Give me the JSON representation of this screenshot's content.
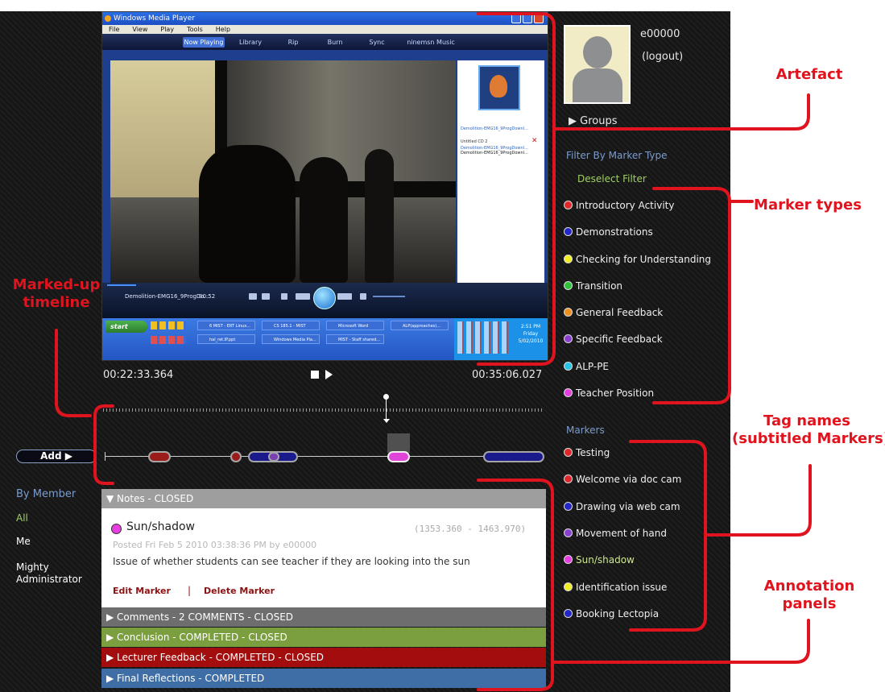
{
  "player": {
    "title": "Windows Media Player",
    "menu": [
      "File",
      "View",
      "Play",
      "Tools",
      "Help"
    ],
    "tabs": [
      "Now Playing",
      "Library",
      "Rip",
      "Burn",
      "Sync",
      "ninemsn Music"
    ],
    "side_items": [
      "Demolition-EMG16_9ProgDownl...",
      "Untitled CD 2",
      "Demolition-EMG16_9ProgDownl...",
      "Demolition-EMG16_9ProgDownl..."
    ],
    "now_playing": "Demolition-EMG16_9ProgDo...",
    "elapsed": "00:52",
    "taskbar": {
      "start": "start",
      "tasks": [
        "6 MIST - ERT Linux...",
        "CS 185.1 - MIST",
        "Microsoft Word",
        "ALP(approaches)...",
        "hal_ret.IP.ppt",
        "Windows Media Pla...",
        "MIST - Staff shared..."
      ],
      "clock": [
        "2:51 PM",
        "Friday",
        "5/02/2010"
      ]
    }
  },
  "timeline": {
    "start_time": "00:22:33.364",
    "end_time": "00:35:06.027",
    "segments": [
      {
        "color": "#9b1b1b"
      },
      {
        "color": "#9b1b1b"
      },
      {
        "color": "#1a1a8c"
      },
      {
        "color": "#7b3fb0"
      },
      {
        "color": "#e044d8"
      },
      {
        "color": "#1a1a8c"
      }
    ]
  },
  "controls": {
    "add_label": "Add ▶"
  },
  "members": {
    "title": "By Member",
    "items": [
      "All",
      "Me",
      "Mighty Administrator"
    ]
  },
  "notes": {
    "header": "▼ Notes - CLOSED",
    "marker_name": "Sun/shadow",
    "range": "(1353.360 - 1463.970)",
    "posted": "Posted Fri Feb 5 2010 03:38:36 PM by e00000",
    "body": "Issue of whether students can see teacher if they are looking into the sun",
    "edit": "Edit Marker",
    "sep": "|",
    "delete": "Delete Marker"
  },
  "panels": [
    {
      "label": "▶ Comments - 2 COMMENTS - CLOSED",
      "color": "#6e6e6e"
    },
    {
      "label": "▶ Conclusion - COMPLETED - CLOSED",
      "color": "#7b9e3f"
    },
    {
      "label": "▶ Lecturer Feedback - COMPLETED - CLOSED",
      "color": "#a30d0d"
    },
    {
      "label": "▶ Final Reflections  - COMPLETED",
      "color": "#3f6ea6"
    }
  ],
  "user": {
    "id": "e00000",
    "logout": "(logout)",
    "groups": "▶  Groups"
  },
  "filter": {
    "title": "Filter By Marker Type",
    "deselect": "Deselect Filter",
    "types": [
      {
        "label": "Introductory Activity",
        "color": "#e0282a"
      },
      {
        "label": "Demonstrations",
        "color": "#2326c8"
      },
      {
        "label": "Checking for Understanding",
        "color": "#f1ee25"
      },
      {
        "label": "Transition",
        "color": "#2ec43a"
      },
      {
        "label": "General Feedback",
        "color": "#ef8f1d"
      },
      {
        "label": "Specific Feedback",
        "color": "#8b3fd0"
      },
      {
        "label": "ALP-PE",
        "color": "#27c2e6"
      },
      {
        "label": "Teacher Position",
        "color": "#e83de0"
      }
    ]
  },
  "markers": {
    "title": "Markers",
    "items": [
      {
        "label": "Testing",
        "color": "#e0282a"
      },
      {
        "label": "Welcome via doc cam",
        "color": "#e0282a"
      },
      {
        "label": "Drawing via web cam",
        "color": "#2326c8"
      },
      {
        "label": "Movement of hand",
        "color": "#8b3fd0"
      },
      {
        "label": "Sun/shadow",
        "color": "#e83de0",
        "selected": true
      },
      {
        "label": "Identification issue",
        "color": "#f1ee25"
      },
      {
        "label": "Booking Lectopia",
        "color": "#2326c8"
      }
    ]
  },
  "callouts": {
    "artefact": "Artefact",
    "marker_types": "Marker types",
    "timeline": [
      "Marked-up",
      "timeline"
    ],
    "tag_names": [
      "Tag names",
      "(subtitled Markers)"
    ],
    "annotation": [
      "Annotation",
      "panels"
    ]
  },
  "colors": {
    "accent_red": "#e0141e",
    "link_blue": "#7a9cd0",
    "all_green": "#9fcf62",
    "deselect_green": "#9fcf62",
    "selected_marker": "#cfe68e"
  }
}
